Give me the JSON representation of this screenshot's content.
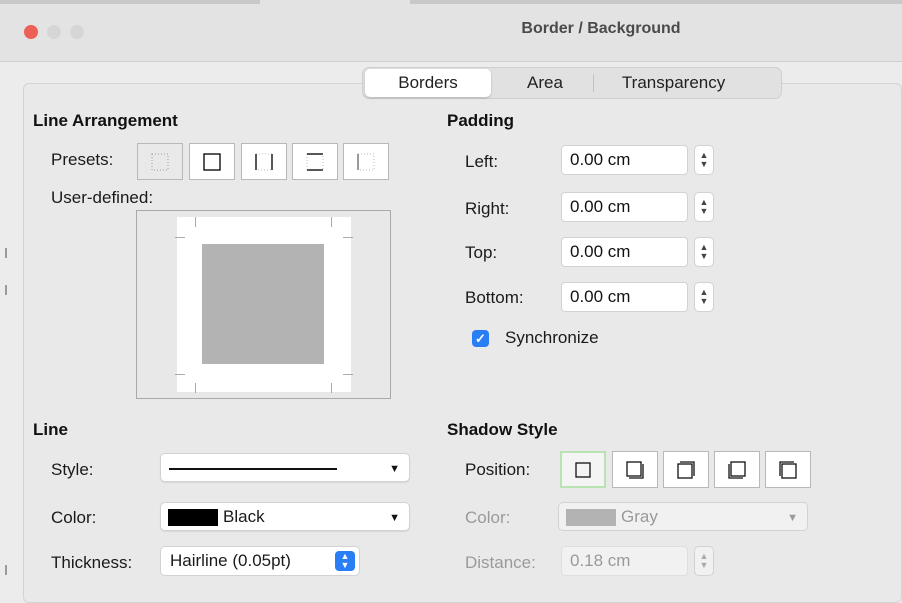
{
  "window": {
    "title": "Border / Background",
    "traffic_colors": {
      "close": "#ee5f58",
      "min": "#d6d6d6",
      "max": "#d6d6d6"
    }
  },
  "tabs": [
    {
      "label": "Borders",
      "active": true
    },
    {
      "label": "Area",
      "active": false
    },
    {
      "label": "Transparency",
      "active": false
    }
  ],
  "line_arrangement": {
    "heading": "Line Arrangement",
    "presets_label": "Presets:",
    "user_defined_label": "User-defined:"
  },
  "padding": {
    "heading": "Padding",
    "left": {
      "label": "Left:",
      "value": "0.00 cm"
    },
    "right": {
      "label": "Right:",
      "value": "0.00 cm"
    },
    "top": {
      "label": "Top:",
      "value": "0.00 cm"
    },
    "bottom": {
      "label": "Bottom:",
      "value": "0.00 cm"
    },
    "synchronize": {
      "label": "Synchronize",
      "checked": true
    }
  },
  "line": {
    "heading": "Line",
    "style_label": "Style:",
    "color_label": "Color:",
    "color_value": "Black",
    "color_swatch": "#000000",
    "thickness_label": "Thickness:",
    "thickness_value": "Hairline (0.05pt)"
  },
  "shadow": {
    "heading": "Shadow Style",
    "position_label": "Position:",
    "color_label": "Color:",
    "color_value": "Gray",
    "color_swatch": "#b3b3b3",
    "distance_label": "Distance:",
    "distance_value": "0.18 cm"
  },
  "accent_color": "#2a7ef5"
}
